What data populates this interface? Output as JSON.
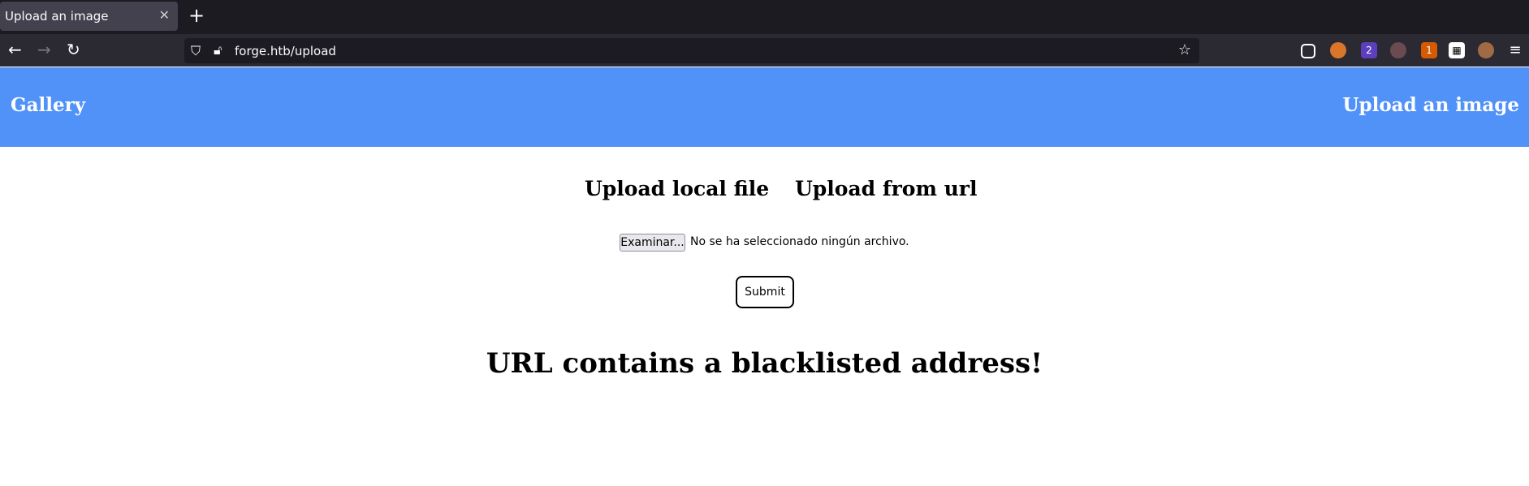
{
  "browser": {
    "tab_title": "Upload an image",
    "url": "forge.htb/upload",
    "extension_badges": {
      "purple": "2",
      "orange": "1"
    }
  },
  "header": {
    "left_link": "Gallery",
    "right_link": "Upload an image",
    "color": "#5192f9"
  },
  "main": {
    "tabs": [
      {
        "label": "Upload local file"
      },
      {
        "label": "Upload from url"
      }
    ],
    "file_button": "Examinar...",
    "file_status": "No se ha seleccionado ningún archivo.",
    "submit_label": "Submit",
    "error_message": "URL contains a blacklisted address!"
  }
}
